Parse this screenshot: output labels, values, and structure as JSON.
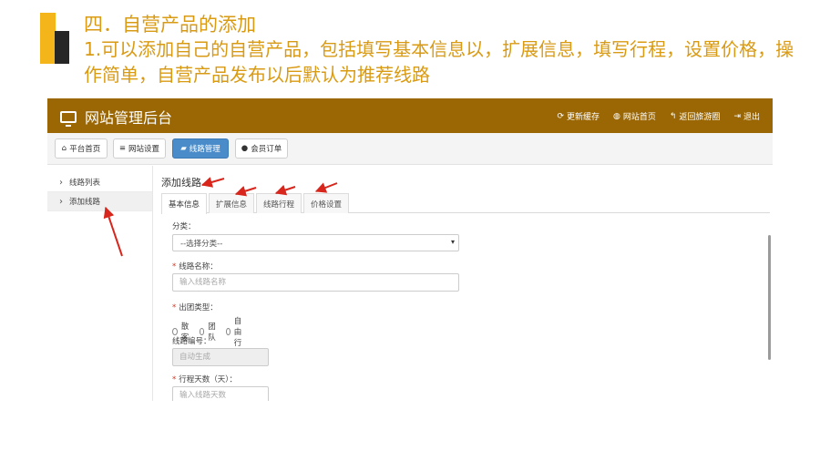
{
  "slide": {
    "title": "四．自营产品的添加",
    "description": "1.可以添加自己的自营产品，包括填写基本信息以，扩展信息，填写行程，设置价格，操作简单，自营产品发布以后默认为推荐线路"
  },
  "admin": {
    "brand": "网站管理后台",
    "top_links": [
      {
        "icon": "refresh-icon",
        "label": "更新缓存"
      },
      {
        "icon": "globe-icon",
        "label": "网站首页"
      },
      {
        "icon": "reply-icon",
        "label": "返回旅游圈"
      },
      {
        "icon": "logout-icon",
        "label": "退出"
      }
    ],
    "nav_buttons": [
      {
        "icon": "home-icon",
        "label": "平台首页",
        "active": false
      },
      {
        "icon": "list-icon",
        "label": "网站设置",
        "active": false
      },
      {
        "icon": "folder-icon",
        "label": "线路管理",
        "active": true
      },
      {
        "icon": "user-icon",
        "label": "会员订单",
        "active": false
      }
    ],
    "sidebar": [
      {
        "label": "线路列表",
        "active": false
      },
      {
        "label": "添加线路",
        "active": true
      }
    ],
    "page_title": "添加线路",
    "tabs": [
      {
        "label": "基本信息",
        "active": true
      },
      {
        "label": "扩展信息",
        "active": false
      },
      {
        "label": "线路行程",
        "active": false
      },
      {
        "label": "价格设置",
        "active": false
      }
    ],
    "form": {
      "category_label": "分类：",
      "category_value": "--选择分类--",
      "name_label": "线路名称：",
      "name_placeholder": "输入线路名称",
      "group_label": "出团类型：",
      "group_options": [
        "散客",
        "团队",
        "自由行"
      ],
      "code_label": "线路编号：",
      "code_placeholder": "自动生成",
      "days_label": "行程天数（天）：",
      "days_placeholder": "输入线路天数"
    },
    "colors": {
      "topbar": "#9a6704",
      "active_button": "#4a8cc9",
      "annotation_arrow": "#d8261c"
    }
  }
}
